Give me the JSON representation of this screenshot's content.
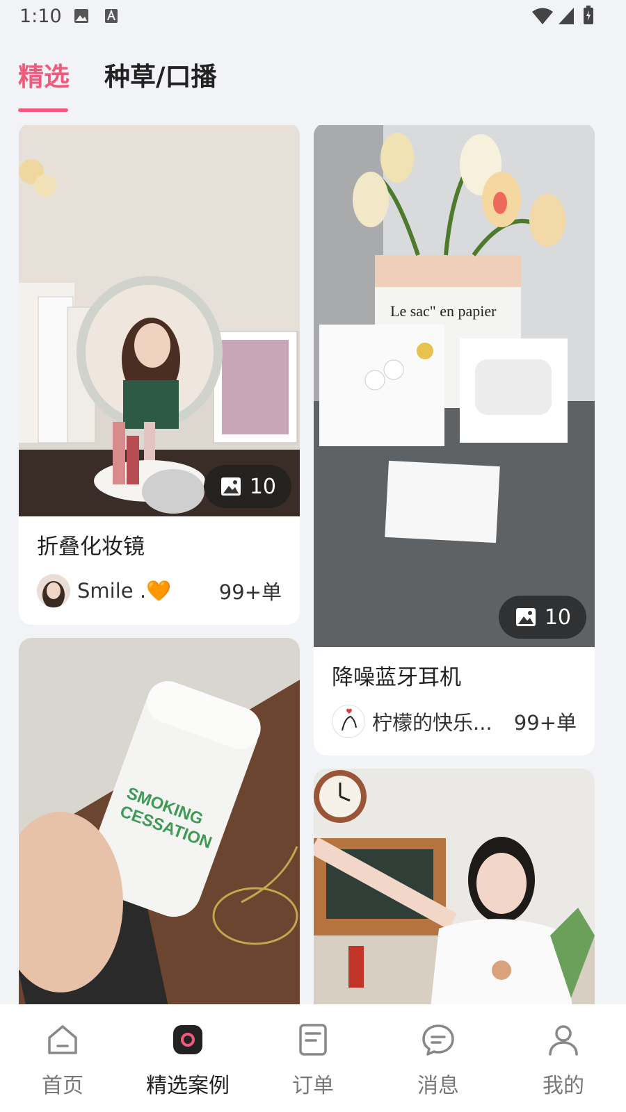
{
  "status_bar": {
    "time": "1:10",
    "icons": [
      "gallery-icon",
      "text-a-icon",
      "wifi-icon",
      "signal-icon",
      "battery-charging-icon"
    ]
  },
  "tabs": [
    {
      "label": "精选",
      "active": true
    },
    {
      "label": "种草/口播",
      "active": false
    }
  ],
  "cards": [
    {
      "title": "折叠化妆镜",
      "image_count": "10",
      "author": "Smile .🧡",
      "orders": "99+单"
    },
    {
      "title": "降噪蓝牙耳机",
      "image_count": "10",
      "author": "柠檬的快乐...",
      "orders": "99+单"
    },
    {
      "title": "",
      "image_count": "",
      "author": "",
      "orders": ""
    },
    {
      "title": "",
      "image_count": "",
      "author": "",
      "orders": ""
    }
  ],
  "nav": [
    {
      "label": "首页",
      "icon": "home-icon",
      "active": false
    },
    {
      "label": "精选案例",
      "icon": "featured-cases-icon",
      "active": true
    },
    {
      "label": "订单",
      "icon": "orders-icon",
      "active": false
    },
    {
      "label": "消息",
      "icon": "message-icon",
      "active": false
    },
    {
      "label": "我的",
      "icon": "profile-icon",
      "active": false
    }
  ],
  "colors": {
    "accent": "#f25a7c",
    "background": "#f2f3f7"
  }
}
